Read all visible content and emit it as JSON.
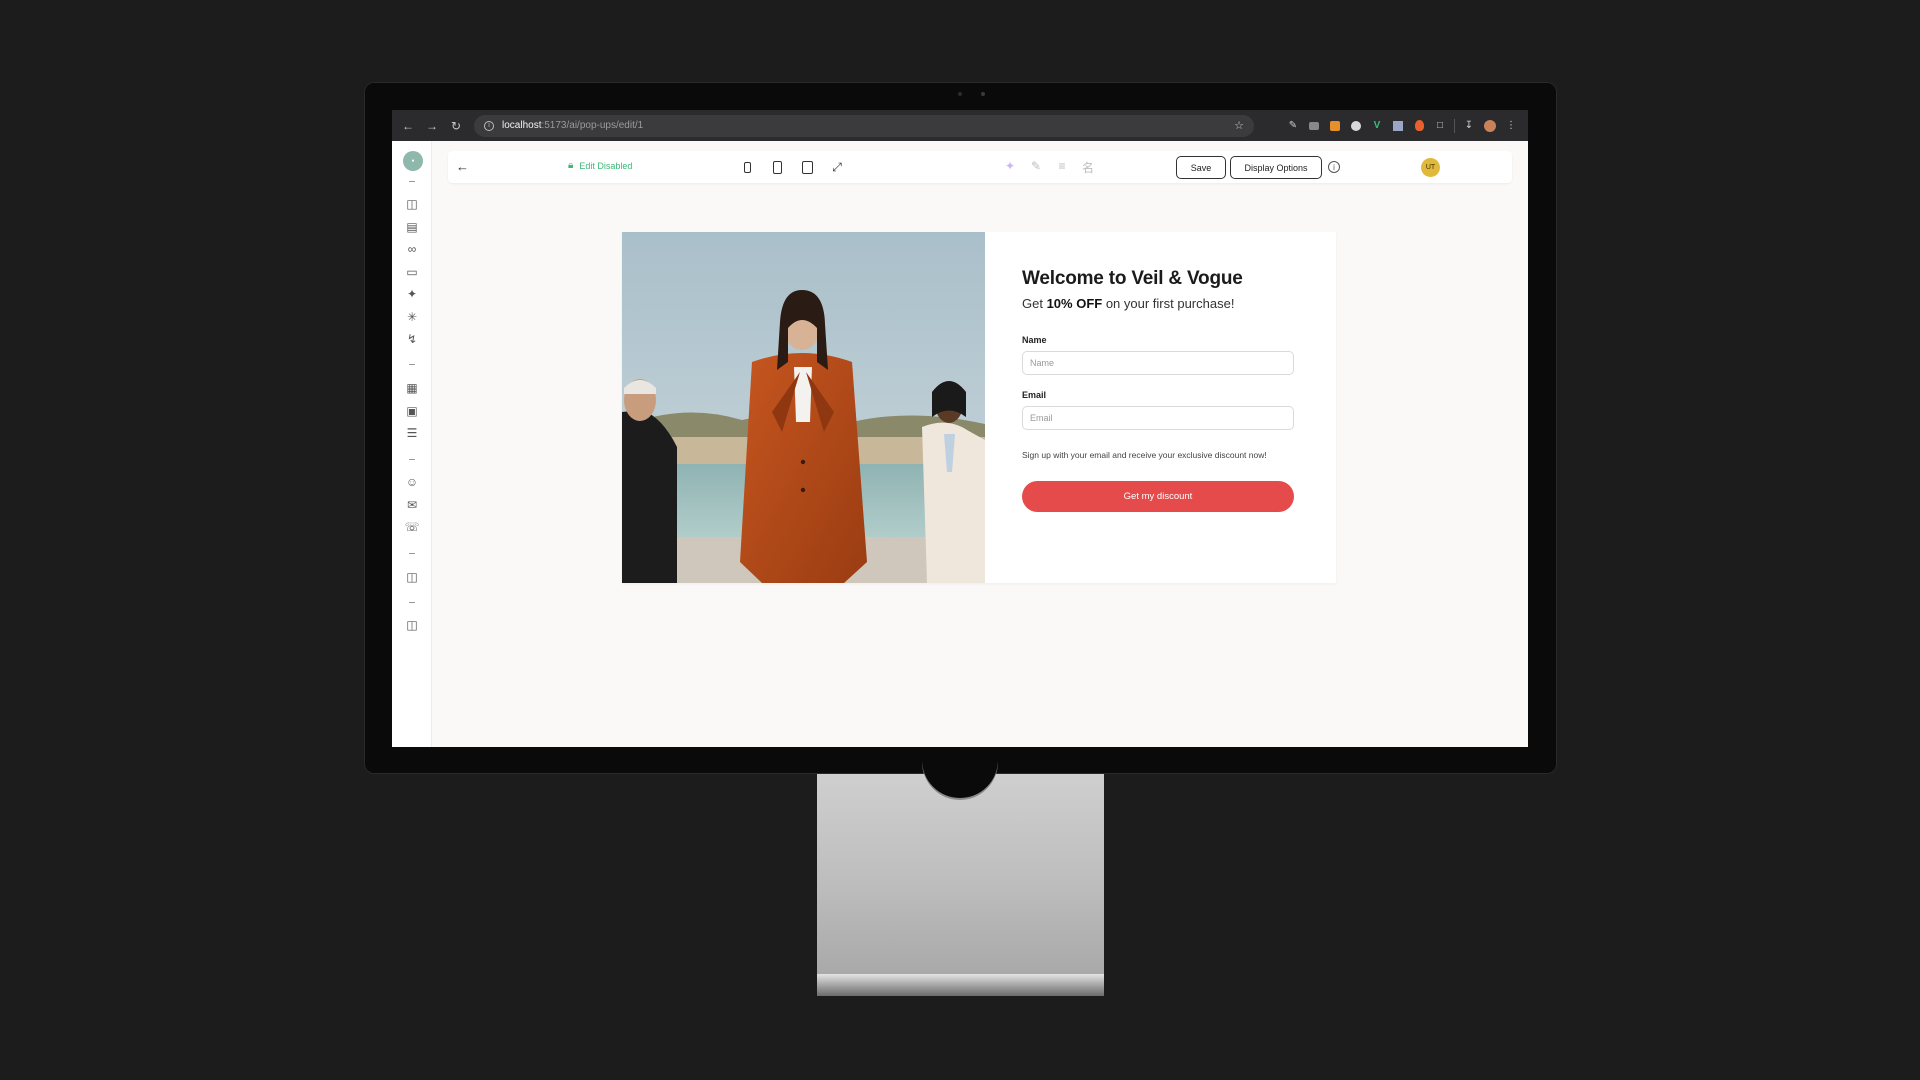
{
  "browser": {
    "url_host": "localhost",
    "url_path": ":5173/ai/pop-ups/edit/1"
  },
  "toolbar": {
    "edit_status": "Edit Disabled",
    "save_label": "Save",
    "display_options_label": "Display Options",
    "avatar_initials": "UT"
  },
  "popup": {
    "title": "Welcome to Veil & Vogue",
    "subtitle_prefix": "Get ",
    "subtitle_bold": "10% OFF",
    "subtitle_suffix": " on your first purchase!",
    "name_label": "Name",
    "name_placeholder": "Name",
    "email_label": "Email",
    "email_placeholder": "Email",
    "note": "Sign up with your email and receive your exclusive discount now!",
    "cta_label": "Get my discount"
  },
  "colors": {
    "cta": "#e54b4b",
    "edit_status": "#3cb777",
    "avatar": "#e1b93a"
  },
  "icons": {
    "rail": [
      "monitor-icon",
      "file-icon",
      "link-icon",
      "folder-icon",
      "sparkles-icon",
      "loader-icon",
      "bolt-icon",
      "layout-icon",
      "window-icon",
      "stack-icon",
      "users-icon",
      "mail-icon",
      "whatsapp-icon",
      "id-card-icon",
      "id-card-icon"
    ]
  }
}
